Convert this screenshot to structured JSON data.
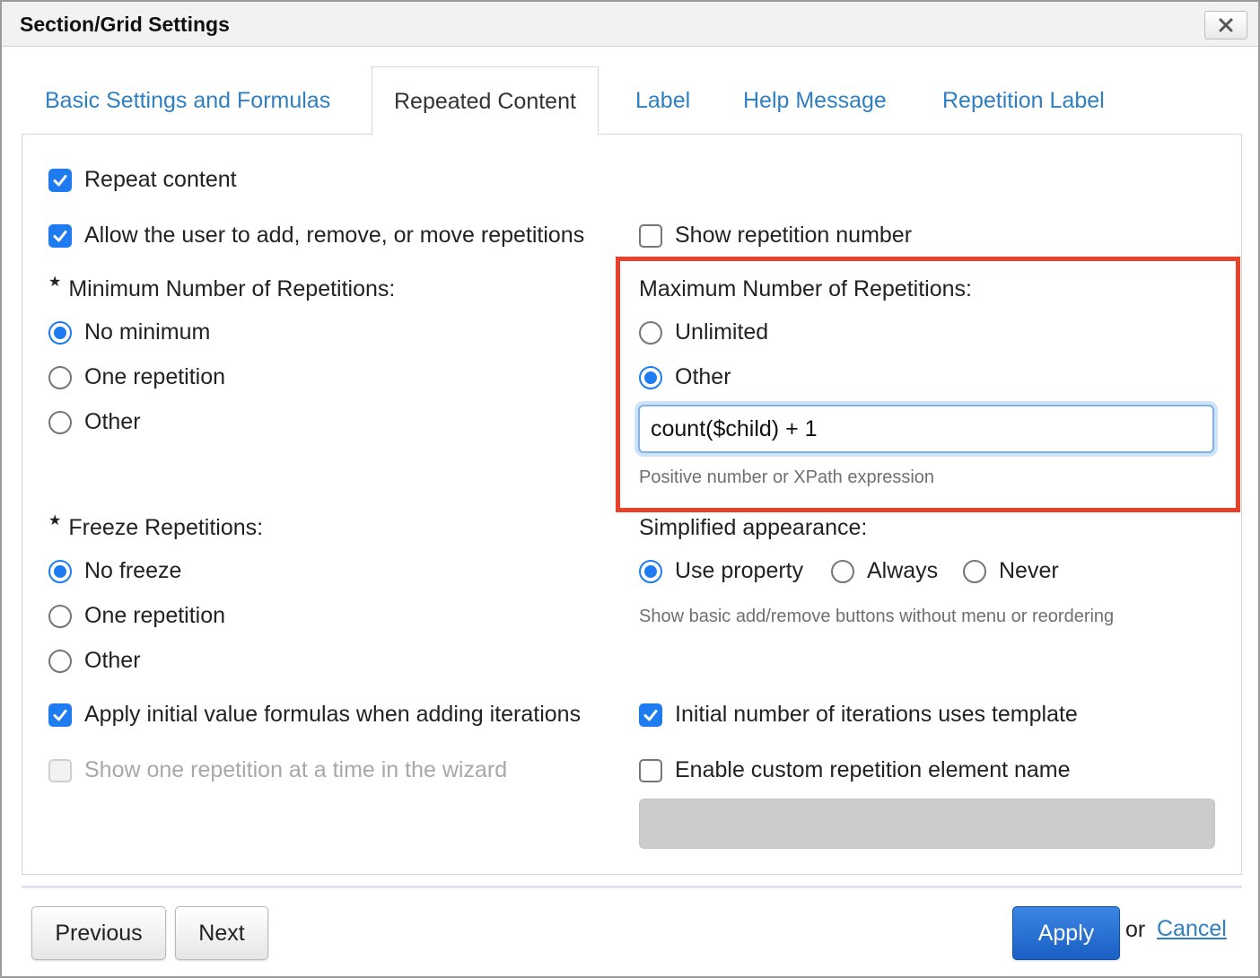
{
  "dialog": {
    "title": "Section/Grid Settings",
    "close_icon": "close-icon"
  },
  "tabs": [
    {
      "label": "Basic Settings and Formulas",
      "active": false
    },
    {
      "label": "Repeated Content",
      "active": true
    },
    {
      "label": "Label",
      "active": false
    },
    {
      "label": "Help Message",
      "active": false
    },
    {
      "label": "Repetition Label",
      "active": false
    }
  ],
  "options": {
    "repeat_content": {
      "label": "Repeat content",
      "checked": true
    },
    "allow_user_edit": {
      "label": "Allow the user to add, remove, or move repetitions",
      "checked": true
    },
    "show_repetition_number": {
      "label": "Show repetition number",
      "checked": false
    },
    "apply_initial_formulas": {
      "label": "Apply initial value formulas when adding iterations",
      "checked": true
    },
    "initial_uses_template": {
      "label": "Initial number of iterations uses template",
      "checked": true
    },
    "show_one_at_a_time": {
      "label": "Show one repetition at a time in the wizard",
      "checked": false,
      "disabled": true
    },
    "custom_element_name": {
      "label": "Enable custom repetition element name",
      "checked": false
    }
  },
  "minimum": {
    "title": "Minimum Number of Repetitions:",
    "required_mark": "★",
    "choices": [
      "No minimum",
      "One repetition",
      "Other"
    ],
    "selected": "No minimum"
  },
  "maximum": {
    "title": "Maximum Number of Repetitions:",
    "choices": [
      "Unlimited",
      "Other"
    ],
    "selected": "Other",
    "value": "count($child) + 1",
    "hint": "Positive number or XPath expression"
  },
  "freeze": {
    "title": "Freeze Repetitions:",
    "required_mark": "★",
    "choices": [
      "No freeze",
      "One repetition",
      "Other"
    ],
    "selected": "No freeze"
  },
  "simplified": {
    "title": "Simplified appearance:",
    "choices": [
      "Use property",
      "Always",
      "Never"
    ],
    "selected": "Use property",
    "hint": "Show basic add/remove buttons without menu or reordering"
  },
  "custom_name_value": "",
  "footer": {
    "previous": "Previous",
    "next": "Next",
    "apply": "Apply",
    "or": "or",
    "cancel": "Cancel"
  },
  "colors": {
    "accent": "#1f7cf0",
    "link": "#2f7fc1",
    "highlight_border": "#e8412b",
    "apply_button": "#1a5fc4"
  }
}
